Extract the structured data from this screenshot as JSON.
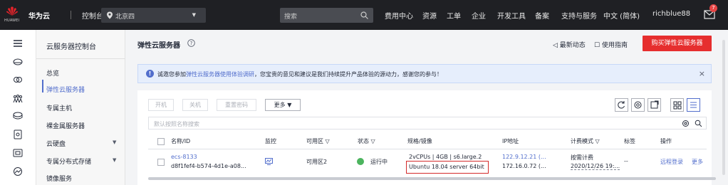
{
  "topbar": {
    "logo_text": "HUAWEI",
    "brand": "华为云",
    "console": "控制台",
    "region": "北京四",
    "search_placeholder": "搜索",
    "nav": [
      "费用中心",
      "资源",
      "工单",
      "企业",
      "开发工具",
      "备案",
      "支持与服务",
      "中文 (简体)",
      "richblue88"
    ],
    "badge_count": "7"
  },
  "sidebar": {
    "title": "云服务器控制台",
    "items": [
      "总览",
      "弹性云服务器",
      "专属主机",
      "裸金属服务器",
      "云硬盘",
      "专属分布式存储",
      "镜像服务"
    ],
    "active": "弹性云服务器"
  },
  "header": {
    "title": "弹性云服务器",
    "latest_news": "最新动态",
    "guide": "使用指南",
    "buy_button": "购买弹性云服务器"
  },
  "notice": {
    "prefix": "诚邀您参加",
    "link": "弹性云服务器使用体验调研",
    "suffix": "，您宝贵的意见和建议是我们持续提升产品体验的源动力，感谢您的参与！",
    "close": "×"
  },
  "toolbar": {
    "start": "开机",
    "stop": "关机",
    "reset_password": "重置密码",
    "more": "更多"
  },
  "filter": {
    "placeholder": "默认按照名称搜索"
  },
  "table": {
    "columns": [
      "名称/ID",
      "监控",
      "可用区",
      "状态",
      "规格/镜像",
      "IP地址",
      "计费模式",
      "标签",
      "操作"
    ],
    "rows": [
      {
        "name": "ecs-8133",
        "id": "d8f1fef4-b574-4d1e-a08...",
        "zone": "可用区2",
        "status": "运行中",
        "spec": "2vCPUs | 4GB | s6.large.2",
        "image": "Ubuntu 18.04 server 64bit",
        "ip_public": "122.9.12.21 (...",
        "ip_private": "172.16.0.72 (...",
        "billing": "按需计费",
        "billing_date": "2020/12/26 19:...",
        "tags": "--",
        "action_login": "远程登录",
        "action_more": "更多"
      }
    ]
  },
  "colors": {
    "topbar_bg": "#1f2024",
    "accent": "#526ecc",
    "buy_button": "#e62e2e",
    "status_running": "#4cb45e",
    "highlight_border": "#d42a2a"
  }
}
